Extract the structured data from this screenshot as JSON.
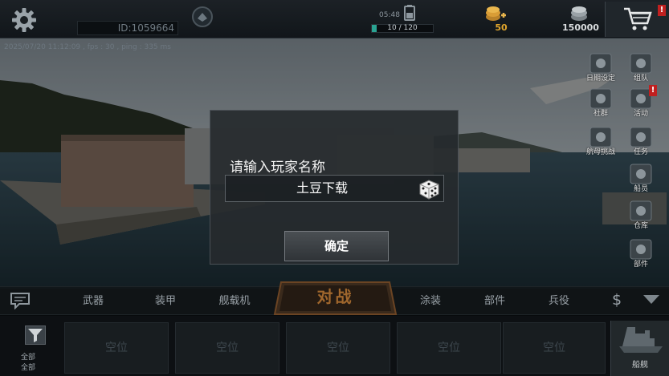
{
  "topbar": {
    "player_id": "ID:1059664",
    "time": "05:48",
    "energy_text": "10 / 120",
    "energy_fraction": 0.083,
    "gold_value": "50",
    "silver_value": "150000",
    "cart_alert": "!"
  },
  "status_text": "2025/07/20 11:12:09 , fps : 30 , ping : 335 ms",
  "side_menu": [
    {
      "label": "日期设定",
      "icon": "clock-icon",
      "alert": ""
    },
    {
      "label": "组队",
      "icon": "flag-icon",
      "alert": ""
    },
    {
      "label": "社群",
      "icon": "community-icon",
      "alert": ""
    },
    {
      "label": "活动",
      "icon": "gift-icon",
      "alert": "!"
    },
    {
      "label": "航母挑战",
      "icon": "carrier-icon",
      "alert": ""
    },
    {
      "label": "任务",
      "icon": "mission-icon",
      "alert": ""
    },
    {
      "label": "船员",
      "icon": "crew-icon",
      "alert": ""
    },
    {
      "label": "仓库",
      "icon": "warehouse-icon",
      "alert": ""
    },
    {
      "label": "部件",
      "icon": "parts-icon",
      "alert": ""
    }
  ],
  "dialog": {
    "title": "请输入玩家名称",
    "name_value": "土豆下载",
    "confirm_label": "确定"
  },
  "tabs": {
    "weapons": "武器",
    "armor": "装甲",
    "aircraft": "舰载机",
    "battle": "对战",
    "paint": "涂装",
    "parts": "部件",
    "crew": "兵役",
    "currency": "$"
  },
  "bottom": {
    "filter_line1": "全部",
    "filter_line2": "全部",
    "slots": [
      "空位",
      "空位",
      "空位",
      "空位",
      "空位"
    ],
    "ship_label": "船舰"
  },
  "colors": {
    "accent_teal": "#2aa392",
    "gold": "#e0a52c",
    "alert_red": "#c02020",
    "battle_orange": "#a0672d"
  }
}
